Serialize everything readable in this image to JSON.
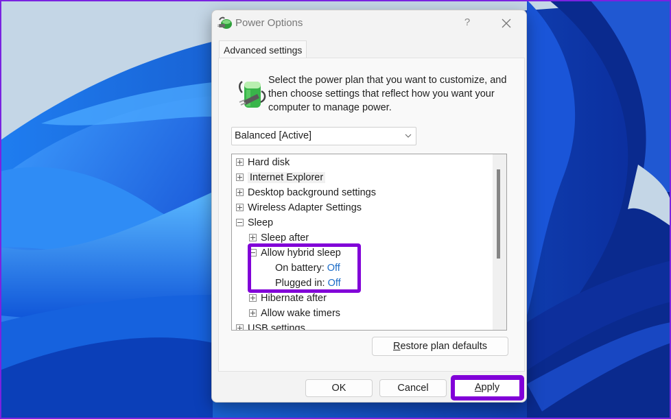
{
  "window": {
    "title": "Power Options",
    "help_label": "?",
    "close_label": "✕",
    "app_icon": "power-options-icon"
  },
  "tab": {
    "label": "Advanced settings"
  },
  "intro": {
    "icon": "battery-plug-icon",
    "text": "Select the power plan that you want to customize, and then choose settings that reflect how you want your computer to manage power."
  },
  "plan_select": {
    "selected": "Balanced [Active]",
    "chevron": "⌄"
  },
  "tree": {
    "items": [
      {
        "label": "Hard disk",
        "state": "collapsed",
        "level": 0
      },
      {
        "label": "Internet Explorer",
        "state": "collapsed",
        "level": 0
      },
      {
        "label": "Desktop background settings",
        "state": "collapsed",
        "level": 0
      },
      {
        "label": "Wireless Adapter Settings",
        "state": "collapsed",
        "level": 0
      },
      {
        "label": "Sleep",
        "state": "expanded",
        "level": 0
      },
      {
        "label": "Sleep after",
        "state": "collapsed",
        "level": 1
      },
      {
        "label": "Allow hybrid sleep",
        "state": "expanded",
        "level": 1
      },
      {
        "label": "On battery:",
        "value": "Off",
        "level": 2
      },
      {
        "label": "Plugged in:",
        "value": "Off",
        "level": 2
      },
      {
        "label": "Hibernate after",
        "state": "collapsed",
        "level": 1
      },
      {
        "label": "Allow wake timers",
        "state": "collapsed",
        "level": 1
      },
      {
        "label": "USB settings",
        "state": "collapsed",
        "level": 0
      }
    ]
  },
  "buttons": {
    "restore_prefix": "R",
    "restore_rest": "estore plan defaults",
    "ok": "OK",
    "cancel": "Cancel",
    "apply_prefix": "A",
    "apply_rest": "pply"
  },
  "colors": {
    "highlight": "#8100d8",
    "value_link": "#1a6bc7"
  }
}
